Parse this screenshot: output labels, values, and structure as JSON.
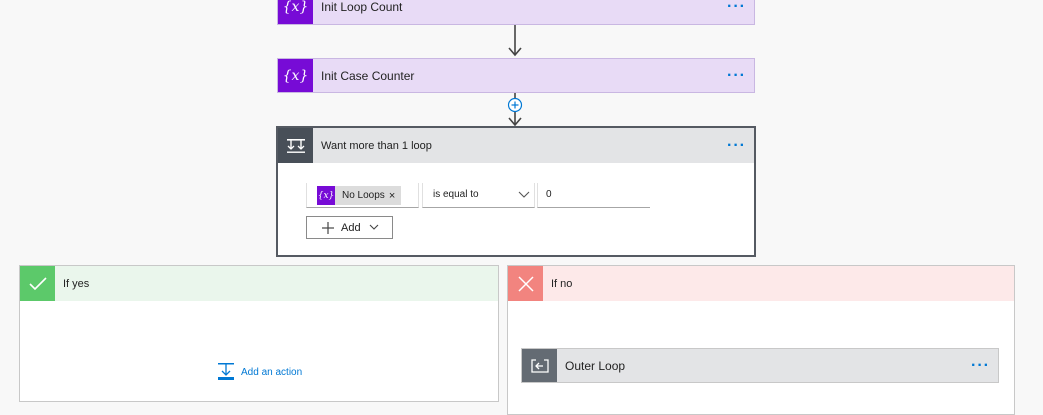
{
  "steps": {
    "init_loop_count": {
      "title": "Init Loop Count",
      "icon": "variable-icon",
      "icon_glyph": "{x}"
    },
    "init_case_counter": {
      "title": "Init Case Counter",
      "icon": "variable-icon",
      "icon_glyph": "{x}"
    }
  },
  "menu_glyph": "···",
  "condition": {
    "title": "Want more than 1 loop",
    "left_operand": {
      "token_label": "No Loops",
      "token_glyph": "{x}",
      "remove_glyph": "×"
    },
    "operator": "is equal to",
    "right_operand": "0",
    "add_label": "Add"
  },
  "branches": {
    "yes": {
      "title": "If yes",
      "add_action_label": "Add an action",
      "color": "#eaf6ec",
      "accent": "#5cc96a"
    },
    "no": {
      "title": "If no",
      "color": "#fde9e9",
      "accent": "#f2847f"
    }
  },
  "outer_loop": {
    "title": "Outer Loop",
    "icon": "loop-icon"
  },
  "colors": {
    "variable_purple": "#770bd6",
    "variable_bg": "#e8dbf6",
    "link_blue": "#0078d4",
    "condition_dark": "#484f58"
  }
}
